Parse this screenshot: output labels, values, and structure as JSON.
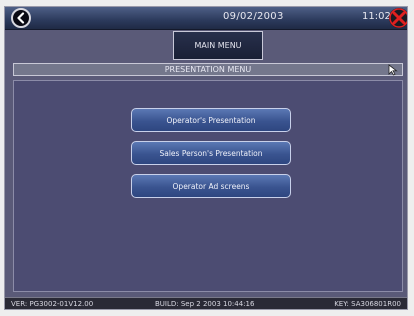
{
  "header": {
    "date": "09/02/2003",
    "time": "11:02"
  },
  "nav": {
    "main_menu_label": "MAIN MENU"
  },
  "section": {
    "title": "PRESENTATION MENU"
  },
  "menu": {
    "items": [
      {
        "label": "Operator's Presentation"
      },
      {
        "label": "Sales Person's Presentation"
      },
      {
        "label": "Operator Ad screens"
      }
    ]
  },
  "status": {
    "version": "VER: PG3002-01V12.00",
    "build": "BUILD: Sep  2 2003  10:44:16",
    "key": "KEY: SA306801R00"
  },
  "icons": {
    "back": "back-arrow-icon",
    "close": "close-x-icon",
    "cursor": "mouse-pointer-icon"
  },
  "colors": {
    "background": "#5a5a78",
    "panel": "#4c4c72",
    "button": "#3a5490",
    "close_accent": "#e02020"
  }
}
